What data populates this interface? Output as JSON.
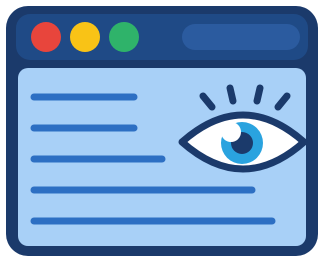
{
  "icon": {
    "name": "browser-window-eye-icon",
    "colors": {
      "frame": "#1b3a6b",
      "titlebar": "#1f4a86",
      "address_pill": "#2b5b9f",
      "content": "#a8d0f7",
      "line": "#2d6fc3",
      "close_dot": "#e8453c",
      "minimize_dot": "#f9c316",
      "maximize_dot": "#2fb36a",
      "eye_white": "#ffffff",
      "iris": "#2aa3df",
      "pupil": "#1b3a6b",
      "highlight": "#ffffff"
    }
  }
}
